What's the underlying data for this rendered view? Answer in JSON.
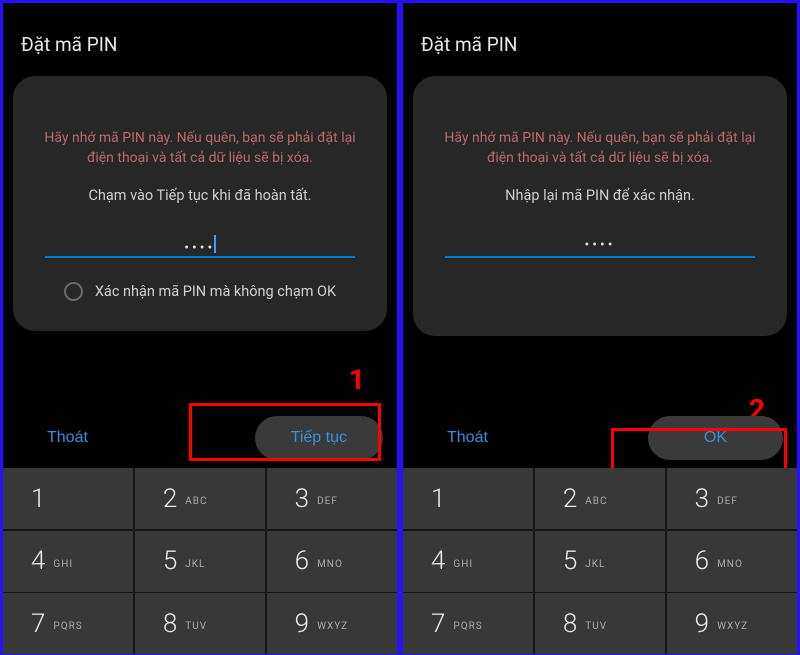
{
  "screens": [
    {
      "title": "Đặt mã PIN",
      "warning": "Hãy nhớ mã PIN này. Nếu quên, bạn sẽ phải đặt lại điện thoại và tất cả dữ liệu sẽ bị xóa.",
      "subtext": "Chạm vào Tiếp tục khi đã hoàn tất.",
      "pin_mask": "••••",
      "show_cursor": true,
      "confirm_option": "Xác nhận mã PIN mà không chạm OK",
      "exit_label": "Thoát",
      "primary_label": "Tiếp tục",
      "step": "1"
    },
    {
      "title": "Đặt mã PIN",
      "warning": "Hãy nhớ mã PIN này. Nếu quên, bạn sẽ phải đặt lại điện thoại và tất cả dữ liệu sẽ bị xóa.",
      "subtext": "Nhập lại mã PIN để xác nhận.",
      "pin_mask": "••••",
      "show_cursor": false,
      "confirm_option": "",
      "exit_label": "Thoát",
      "primary_label": "OK",
      "step": "2"
    }
  ],
  "keypad": [
    {
      "num": "1",
      "letters": ""
    },
    {
      "num": "2",
      "letters": "ABC"
    },
    {
      "num": "3",
      "letters": "DEF"
    },
    {
      "num": "4",
      "letters": "GHI"
    },
    {
      "num": "5",
      "letters": "JKL"
    },
    {
      "num": "6",
      "letters": "MNO"
    },
    {
      "num": "7",
      "letters": "PQRS"
    },
    {
      "num": "8",
      "letters": "TUV"
    },
    {
      "num": "9",
      "letters": "WXYZ"
    }
  ]
}
